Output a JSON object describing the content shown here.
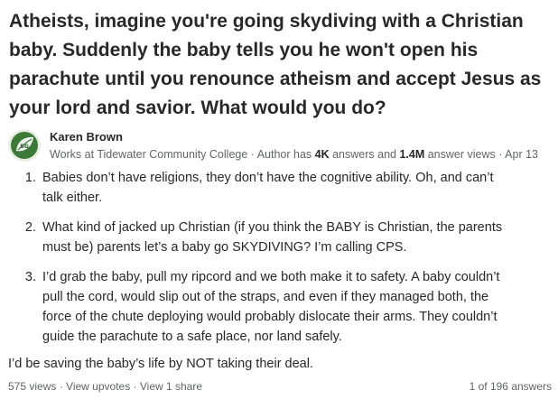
{
  "question": {
    "title": "Atheists, imagine you're going skydiving with a Christian baby. Suddenly the baby tells you he won't open his parachute until you renounce atheism and accept Jesus as your lord and savior. What would you do?"
  },
  "author": {
    "name": "Karen Brown",
    "credential_prefix": "Works at Tidewater Community College · Author has ",
    "answers_count": "4K",
    "answers_label": " answers and ",
    "views_count": "1.4M",
    "views_label": " answer views · Apr 13",
    "avatar_icon": "leaf-logo-icon"
  },
  "answer": {
    "items": [
      "Babies don’t have religions, they don’t have the cognitive ability. Oh, and can’t talk either.",
      "What kind of jacked up Christian (if you think the BABY is Christian, the parents must be) parents let’s a baby go SKYDIVING? I’m calling CPS.",
      "I’d grab the baby, pull my ripcord and we both make it to safety. A baby couldn’t pull the cord, would slip out of the straps, and even if they managed both, the force of the chute deploying would probably dislocate their arms. They couldn’t guide the parachute to a safe place, nor land safely."
    ],
    "closing": "I’d be saving the baby’s life by NOT taking their deal."
  },
  "footer": {
    "views": "575 views",
    "separator": " · ",
    "upvotes_link": "View upvotes",
    "share_link": "View 1 share",
    "pagination": "1 of 196 answers"
  },
  "colors": {
    "text": "#282829",
    "muted": "#636466",
    "avatar_green": "#3d7a3a"
  }
}
